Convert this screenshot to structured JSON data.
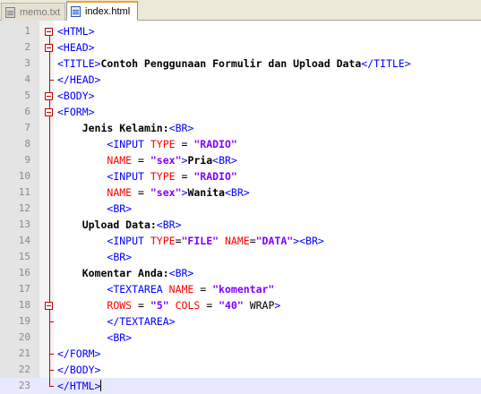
{
  "tabs": [
    {
      "label": "memo.txt",
      "icon": "text-file-icon",
      "active": false
    },
    {
      "label": "index.html",
      "icon": "html-file-icon",
      "active": true
    }
  ],
  "colors": {
    "tag": "#0000ff",
    "attribute": "#ff0000",
    "string": "#8000ff",
    "fold_marker": "#c40000"
  },
  "current_line": 23,
  "lines": [
    {
      "n": "1",
      "code": [
        {
          "c": "t",
          "v": "<HTML>"
        }
      ]
    },
    {
      "n": "2",
      "code": [
        {
          "c": "t",
          "v": "<HEAD>"
        }
      ]
    },
    {
      "n": "3",
      "code": [
        {
          "c": "t",
          "v": "<TITLE>"
        },
        {
          "c": "x",
          "v": "Contoh Penggunaan Formulir dan Upload Data"
        },
        {
          "c": "t",
          "v": "</TITLE>"
        }
      ]
    },
    {
      "n": "4",
      "code": [
        {
          "c": "t",
          "v": "</HEAD>"
        }
      ]
    },
    {
      "n": "5",
      "code": [
        {
          "c": "t",
          "v": "<BODY>"
        }
      ]
    },
    {
      "n": "6",
      "code": [
        {
          "c": "t",
          "v": "<FORM>"
        }
      ]
    },
    {
      "n": "7",
      "code": [
        {
          "c": "p",
          "v": "    "
        },
        {
          "c": "x",
          "v": "Jenis Kelamin:"
        },
        {
          "c": "t",
          "v": "<BR>"
        }
      ]
    },
    {
      "n": "8",
      "code": [
        {
          "c": "p",
          "v": "        "
        },
        {
          "c": "t",
          "v": "<INPUT "
        },
        {
          "c": "a",
          "v": "TYPE"
        },
        {
          "c": "p",
          "v": " = "
        },
        {
          "c": "s",
          "v": "\"RADIO\""
        }
      ]
    },
    {
      "n": "9",
      "code": [
        {
          "c": "p",
          "v": "        "
        },
        {
          "c": "a",
          "v": "NAME"
        },
        {
          "c": "p",
          "v": " = "
        },
        {
          "c": "s",
          "v": "\"sex\""
        },
        {
          "c": "t",
          "v": ">"
        },
        {
          "c": "x",
          "v": "Pria"
        },
        {
          "c": "t",
          "v": "<BR>"
        }
      ]
    },
    {
      "n": "10",
      "code": [
        {
          "c": "p",
          "v": "        "
        },
        {
          "c": "t",
          "v": "<INPUT "
        },
        {
          "c": "a",
          "v": "TYPE"
        },
        {
          "c": "p",
          "v": " = "
        },
        {
          "c": "s",
          "v": "\"RADIO\""
        }
      ]
    },
    {
      "n": "11",
      "code": [
        {
          "c": "p",
          "v": "        "
        },
        {
          "c": "a",
          "v": "NAME"
        },
        {
          "c": "p",
          "v": " = "
        },
        {
          "c": "s",
          "v": "\"sex\""
        },
        {
          "c": "t",
          "v": ">"
        },
        {
          "c": "x",
          "v": "Wanita"
        },
        {
          "c": "t",
          "v": "<BR>"
        }
      ]
    },
    {
      "n": "12",
      "code": [
        {
          "c": "p",
          "v": "        "
        },
        {
          "c": "t",
          "v": "<BR>"
        }
      ]
    },
    {
      "n": "13",
      "code": [
        {
          "c": "p",
          "v": "    "
        },
        {
          "c": "x",
          "v": "Upload Data:"
        },
        {
          "c": "t",
          "v": "<BR>"
        }
      ]
    },
    {
      "n": "14",
      "code": [
        {
          "c": "p",
          "v": "        "
        },
        {
          "c": "t",
          "v": "<INPUT "
        },
        {
          "c": "a",
          "v": "TYPE"
        },
        {
          "c": "p",
          "v": "="
        },
        {
          "c": "s",
          "v": "\"FILE\""
        },
        {
          "c": "p",
          "v": " "
        },
        {
          "c": "a",
          "v": "NAME"
        },
        {
          "c": "p",
          "v": "="
        },
        {
          "c": "s",
          "v": "\"DATA\""
        },
        {
          "c": "t",
          "v": "><BR>"
        }
      ]
    },
    {
      "n": "15",
      "code": [
        {
          "c": "p",
          "v": "        "
        },
        {
          "c": "t",
          "v": "<BR>"
        }
      ]
    },
    {
      "n": "16",
      "code": [
        {
          "c": "p",
          "v": "    "
        },
        {
          "c": "x",
          "v": "Komentar Anda:"
        },
        {
          "c": "t",
          "v": "<BR>"
        }
      ]
    },
    {
      "n": "17",
      "code": [
        {
          "c": "p",
          "v": "        "
        },
        {
          "c": "t",
          "v": "<TEXTAREA "
        },
        {
          "c": "a",
          "v": "NAME"
        },
        {
          "c": "p",
          "v": " = "
        },
        {
          "c": "s",
          "v": "\"komentar\""
        }
      ]
    },
    {
      "n": "18",
      "code": [
        {
          "c": "p",
          "v": "        "
        },
        {
          "c": "a",
          "v": "ROWS"
        },
        {
          "c": "p",
          "v": " = "
        },
        {
          "c": "s",
          "v": "\"5\""
        },
        {
          "c": "p",
          "v": " "
        },
        {
          "c": "a",
          "v": "COLS"
        },
        {
          "c": "p",
          "v": " = "
        },
        {
          "c": "s",
          "v": "\"40\""
        },
        {
          "c": "p",
          "v": " WRAP"
        },
        {
          "c": "t",
          "v": ">"
        }
      ]
    },
    {
      "n": "19",
      "code": [
        {
          "c": "p",
          "v": "        "
        },
        {
          "c": "t",
          "v": "</TEXTAREA>"
        }
      ]
    },
    {
      "n": "20",
      "code": [
        {
          "c": "p",
          "v": "        "
        },
        {
          "c": "t",
          "v": "<BR>"
        }
      ]
    },
    {
      "n": "21",
      "code": [
        {
          "c": "t",
          "v": "</FORM>"
        }
      ]
    },
    {
      "n": "22",
      "code": [
        {
          "c": "t",
          "v": "</BODY>"
        }
      ]
    },
    {
      "n": "23",
      "code": [
        {
          "c": "t",
          "v": "</HTML>"
        }
      ]
    }
  ]
}
